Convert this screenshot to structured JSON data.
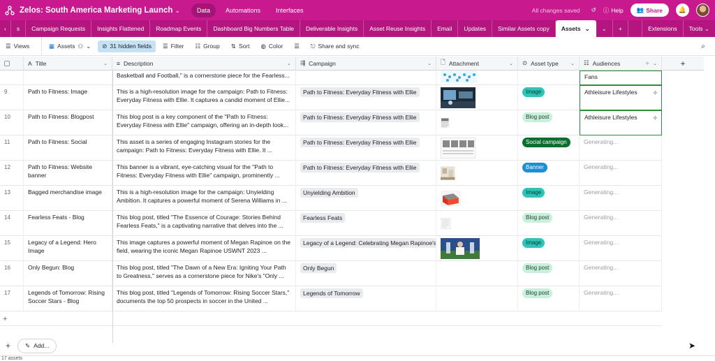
{
  "topbar": {
    "base_title": "Zelos: South America Marketing Launch",
    "nav": [
      "Data",
      "Automations",
      "Interfaces"
    ],
    "saved_status": "All changes saved",
    "help_label": "Help",
    "share_label": "Share",
    "brand_color": "#c8198f"
  },
  "tabs": {
    "items": [
      "s",
      "Campaign Requests",
      "Insights Flattened",
      "Roadmap Events",
      "Dashboard Big Numbers Table",
      "Deliverable Insights",
      "Asset Reuse Insights",
      "Email",
      "Updates",
      "Similar Assets copy"
    ],
    "active": "Assets",
    "right": [
      "Extensions",
      "Tools"
    ]
  },
  "toolbar": {
    "views": "Views",
    "view_name": "Assets",
    "hidden_fields": "31 hidden fields",
    "filter": "Filter",
    "group": "Group",
    "sort": "Sort",
    "color": "Color",
    "share_sync": "Share and sync"
  },
  "columns": {
    "title": "Title",
    "description": "Description",
    "campaign": "Campaign",
    "attachment": "Attachment",
    "asset_type": "Asset type",
    "audiences": "Audiences"
  },
  "partial_row": {
    "description": "Basketball and Football,\" is a cornerstone piece for the Fearless...",
    "audience": "Fans"
  },
  "rows": [
    {
      "num": "9",
      "title": "Path to Fitness: Image",
      "description": "This is a high-resolution image for the campaign: Path to Fitness: Everyday Fitness with Ellie. It captures a candid moment of Ellie...",
      "campaign": "Path to Fitness: Everyday Fitness with Ellie",
      "asset_type": "Image",
      "audience": "Athleisure Lifestyles"
    },
    {
      "num": "10",
      "title": "Path to Fitness: Blogpost",
      "description": "This blog post is a key component of the \"Path to Fitness: Everyday Fitness with Ellie\" campaign, offering an in-depth look...",
      "campaign": "Path to Fitness: Everyday Fitness with Ellie",
      "asset_type": "Blog post",
      "audience": "Athleisure Lifestyles"
    },
    {
      "num": "11",
      "title": "Path to Fitness: Social",
      "description": "This asset is a series of engaging Instagram stories for the campaign: Path to Fitness: Everyday Fitness with Ellie. It ...",
      "campaign": "Path to Fitness: Everyday Fitness with Ellie",
      "asset_type": "Social campaign",
      "audience": "Generating..."
    },
    {
      "num": "12",
      "title": "Path to Fitness: Website banner",
      "description": "This banner is a vibrant, eye-catching visual for the \"Path to Fitness: Everyday Fitness with Ellie\" campaign, prominently ...",
      "campaign": "Path to Fitness: Everyday Fitness with Ellie",
      "asset_type": "Banner",
      "audience": "Generating..."
    },
    {
      "num": "13",
      "title": "Bagged merchandise image",
      "description": "This is a high-resolution image for the campaign: Unyielding Ambition. It captures a powerful moment of Serena Williams in ...",
      "campaign": "Unyielding Ambition",
      "asset_type": "Image",
      "audience": "Generating..."
    },
    {
      "num": "14",
      "title": "Fearless Feats - Blog",
      "description": "This blog post, titled \"The Essence of Courage: Stories Behind Fearless Feats,\" is a captivating narrative that delves into the ...",
      "campaign": "Fearless Feats",
      "asset_type": "Blog post",
      "audience": "Generating..."
    },
    {
      "num": "15",
      "title": "Legacy of a Legend: Hero Image",
      "description": "This image captures a powerful moment of Megan Rapinoe on the field, wearing the iconic Megan Rapinoe USWNT 2023 ...",
      "campaign": "Legacy of a Legend: Celebrating Megan Rapinoe's",
      "asset_type": "Image",
      "audience": "Generating..."
    },
    {
      "num": "16",
      "title": "Only Begun: Blog",
      "description": "This blog post, titled \"The Dawn of a New Era: Igniting Your Path to Greatness,\" serves as a cornerstone piece for Nike's \"Only ...",
      "campaign": "Only Begun",
      "asset_type": "Blog post",
      "audience": "Generating..."
    },
    {
      "num": "17",
      "title": "Legends of Tomorrow: Rising Soccer Stars - Blog",
      "description": "This blog post, titled \"Legends of Tomorrow: Rising Soccer Stars,\" documents the top 50 prospects in soccer in the United ...",
      "campaign": "Legends of Tomorrow",
      "asset_type": "Blog post",
      "audience": "Generating..."
    }
  ],
  "bottom": {
    "add_label": "Add...",
    "record_count": "17 assets"
  }
}
